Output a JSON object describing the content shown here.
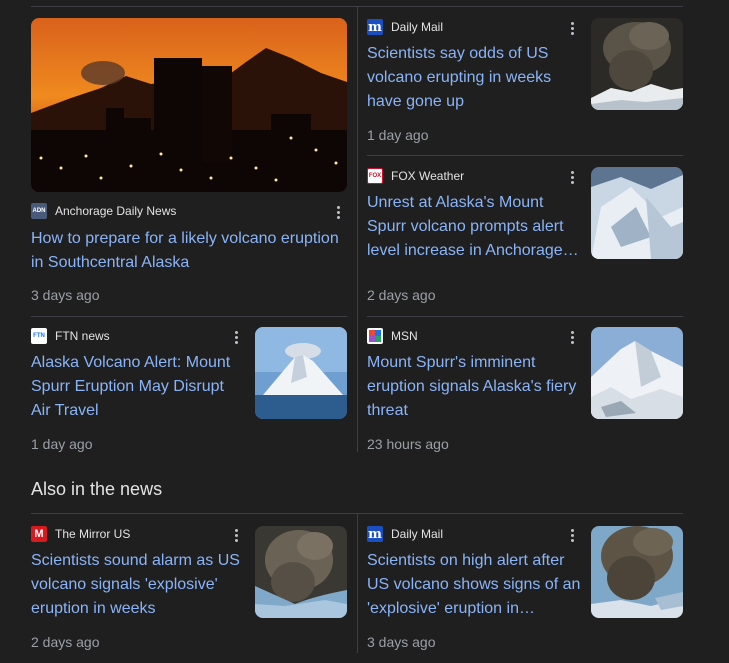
{
  "top_grid": {
    "hero": {
      "source": "Anchorage Daily News",
      "favicon": "ADN",
      "title": "How to prepare for a likely volcano eruption in Southcentral Alaska",
      "time": "3 days ago"
    },
    "card_dailymail": {
      "source": "Daily Mail",
      "favicon": "m",
      "title": "Scientists say odds of US volcano erupting in weeks have gone up",
      "time": "1 day ago"
    },
    "card_foxweather": {
      "source": "FOX Weather",
      "favicon": "FOX",
      "title": "Unrest at Alaska's Mount Spurr volcano prompts alert level increase in Anchorage…",
      "time": "2 days ago"
    },
    "card_ftn": {
      "source": "FTN news",
      "favicon": "FTN",
      "title": "Alaska Volcano Alert: Mount Spurr Eruption May Disrupt Air Travel",
      "time": "1 day ago"
    },
    "card_msn": {
      "source": "MSN",
      "favicon": "msn-logo",
      "title": "Mount Spurr's imminent eruption signals Alaska's fiery threat",
      "time": "23 hours ago"
    }
  },
  "also_in_news": {
    "heading": "Also in the news",
    "card_mirror": {
      "source": "The Mirror US",
      "favicon": "M",
      "title": "Scientists sound alarm as US volcano signals 'explosive' eruption in weeks",
      "time": "2 days ago"
    },
    "card_dailymail2": {
      "source": "Daily Mail",
      "favicon": "m",
      "title": "Scientists on high alert after US volcano shows signs of an 'explosive' eruption in…",
      "time": "3 days ago"
    }
  },
  "colors": {
    "background": "#1f1f1f",
    "link": "#8ab4f8",
    "muted": "#9aa0a6",
    "divider": "#3c4043"
  }
}
